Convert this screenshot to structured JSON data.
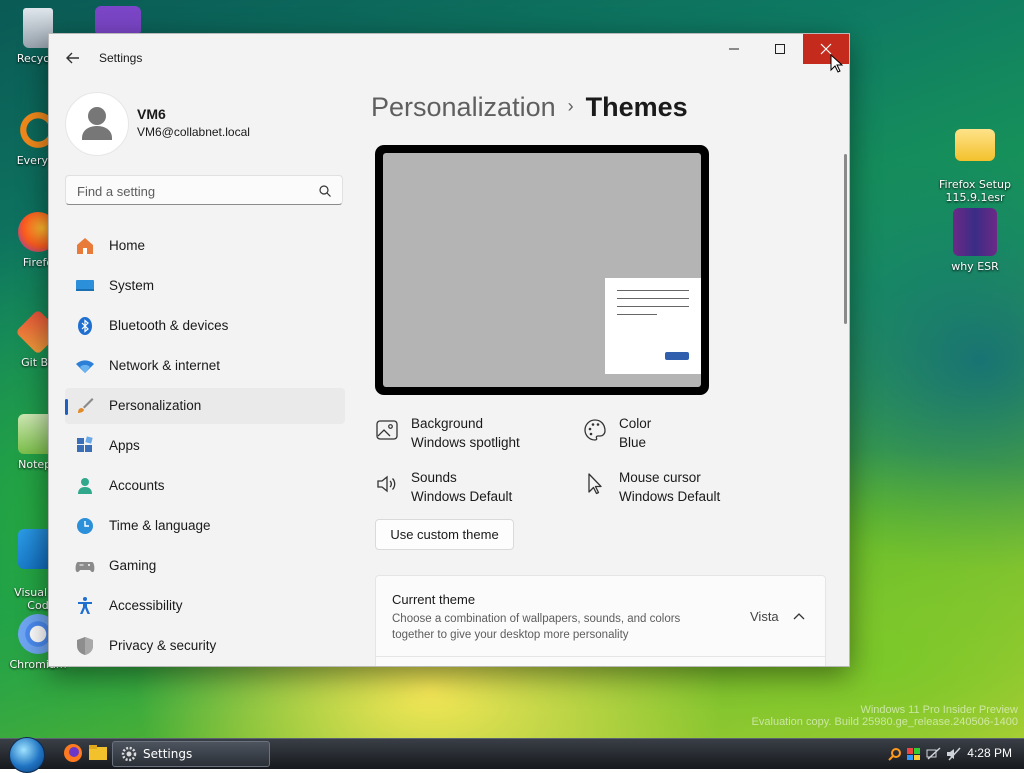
{
  "desktop": {
    "icons": [
      {
        "id": "recycle",
        "label": "Recycle"
      },
      {
        "id": "everything",
        "label": "Everyth"
      },
      {
        "id": "firefox",
        "label": "Firefo"
      },
      {
        "id": "gitbash",
        "label": "Git Ba"
      },
      {
        "id": "notepad",
        "label": "Notepa"
      },
      {
        "id": "vscode",
        "label": "Visual St\nCod"
      },
      {
        "id": "chromium",
        "label": "Chromium"
      },
      {
        "id": "firefox-setup",
        "label": "Firefox Setup\n115.9.1esr"
      },
      {
        "id": "why-esr",
        "label": "why ESR"
      }
    ],
    "watermark_line1": "Windows 11 Pro Insider Preview",
    "watermark_line2": "Evaluation copy. Build 25980.ge_release.240506-1400"
  },
  "taskbar": {
    "settings_label": "Settings",
    "clock": "4:28 PM"
  },
  "window": {
    "title": "Settings",
    "accent": "#1f5fbf",
    "close_color": "#c42b1c"
  },
  "profile": {
    "name": "VM6",
    "email": "VM6@collabnet.local"
  },
  "search": {
    "placeholder": "Find a setting"
  },
  "nav": {
    "items": [
      {
        "label": "Home",
        "icon": "home-icon"
      },
      {
        "label": "System",
        "icon": "system-icon"
      },
      {
        "label": "Bluetooth & devices",
        "icon": "bluetooth-icon"
      },
      {
        "label": "Network & internet",
        "icon": "wifi-icon"
      },
      {
        "label": "Personalization",
        "icon": "brush-icon",
        "active": true
      },
      {
        "label": "Apps",
        "icon": "apps-icon"
      },
      {
        "label": "Accounts",
        "icon": "account-icon"
      },
      {
        "label": "Time & language",
        "icon": "clock-globe-icon"
      },
      {
        "label": "Gaming",
        "icon": "gamepad-icon"
      },
      {
        "label": "Accessibility",
        "icon": "accessibility-icon"
      },
      {
        "label": "Privacy & security",
        "icon": "shield-icon"
      }
    ]
  },
  "breadcrumb": {
    "parent": "Personalization",
    "separator": "›",
    "current": "Themes"
  },
  "theme_props": {
    "background": {
      "title": "Background",
      "value": "Windows spotlight"
    },
    "color": {
      "title": "Color",
      "value": "Blue"
    },
    "sounds": {
      "title": "Sounds",
      "value": "Windows Default"
    },
    "cursor": {
      "title": "Mouse cursor",
      "value": "Windows Default"
    }
  },
  "custom_theme_button": "Use custom theme",
  "current_theme": {
    "title": "Current theme",
    "description": "Choose a combination of wallpapers, sounds, and colors together to give your desktop more personality",
    "value": "Vista"
  }
}
